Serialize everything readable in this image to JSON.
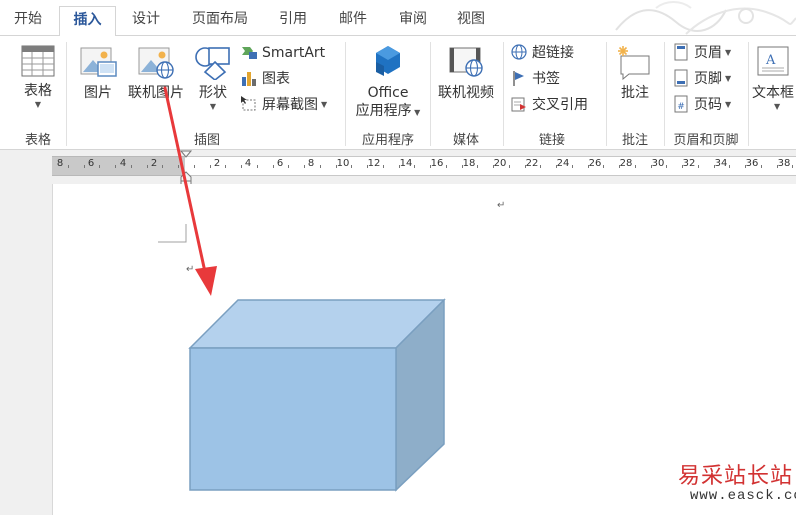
{
  "tabs": [
    "开始",
    "插入",
    "设计",
    "页面布局",
    "引用",
    "邮件",
    "审阅",
    "视图"
  ],
  "active_tab": "插入",
  "ribbon": {
    "table": {
      "button": "表格",
      "group": "表格"
    },
    "illustrations": {
      "group": "插图",
      "picture": "图片",
      "online_picture": "联机图片",
      "shapes": "形状",
      "smartart": "SmartArt",
      "chart": "图表",
      "screenshot": "屏幕截图"
    },
    "apps": {
      "group": "应用程序",
      "office_line1": "Office",
      "office_line2": "应用程序"
    },
    "media": {
      "group": "媒体",
      "online_video": "联机视频"
    },
    "links": {
      "group": "链接",
      "hyperlink": "超链接",
      "bookmark": "书签",
      "cross_ref": "交叉引用"
    },
    "comments": {
      "group": "批注",
      "comment": "批注"
    },
    "header_footer": {
      "group": "页眉和页脚",
      "header": "页眉",
      "footer": "页脚",
      "page_number": "页码"
    },
    "text": {
      "textbox": "文本框"
    }
  },
  "ruler": {
    "left_numbers": [
      "8",
      "6",
      "4",
      "2"
    ],
    "right_numbers": [
      "2",
      "4",
      "6",
      "8",
      "10",
      "12",
      "14",
      "16",
      "18",
      "20",
      "22",
      "24",
      "26",
      "28",
      "30",
      "32",
      "34",
      "36",
      "38"
    ]
  },
  "document": {
    "paragraph_mark": "↵"
  },
  "watermark": {
    "text": "易采站长站",
    "url": "www.easck.com"
  },
  "colors": {
    "accent": "#2b579a",
    "arrow": "#e8393b",
    "cube_front": "#9dc3e6",
    "cube_top": "#b4d1ed",
    "cube_side": "#8eaec9",
    "cube_border": "#7a9fc0"
  }
}
